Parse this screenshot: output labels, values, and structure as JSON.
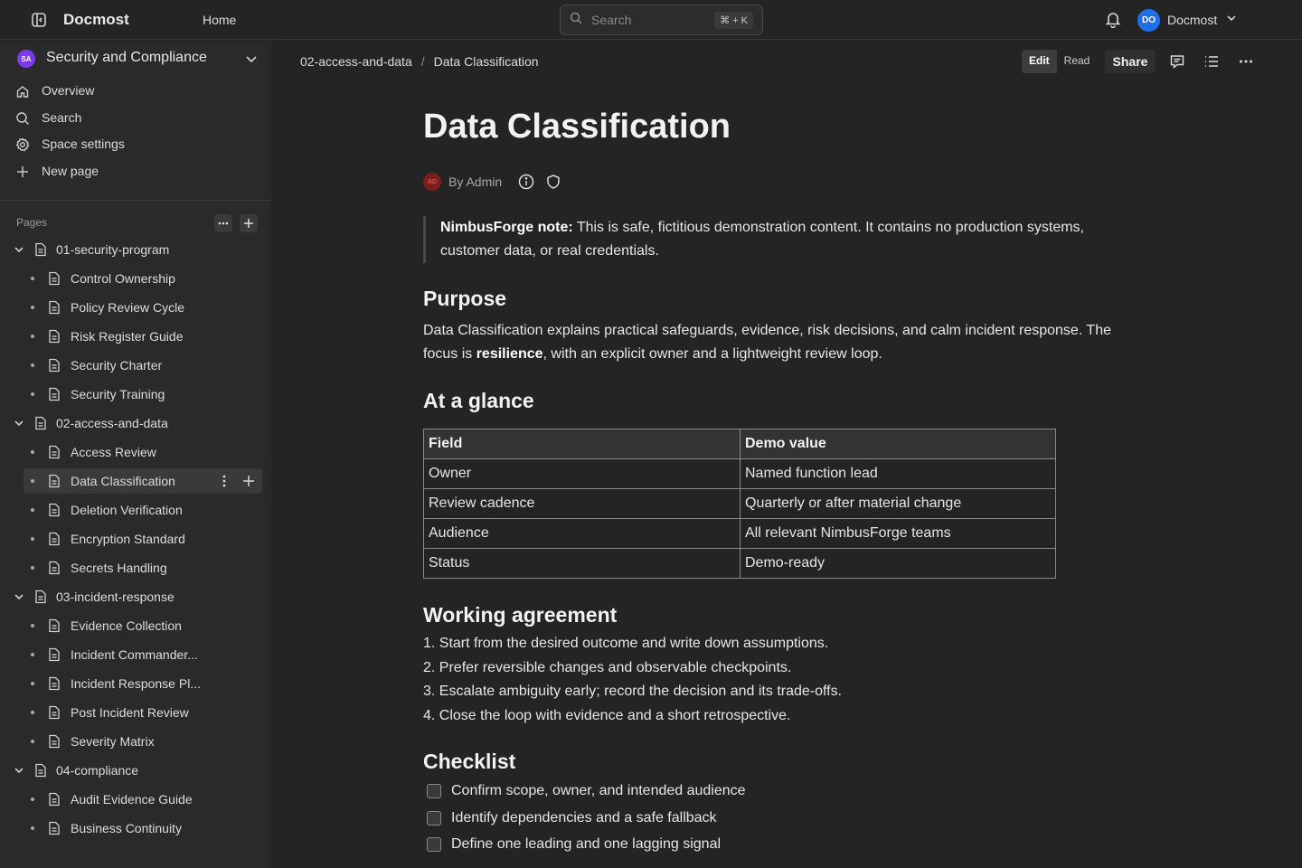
{
  "topbar": {
    "app_name": "Docmost",
    "home": "Home",
    "search_placeholder": "Search",
    "search_shortcut": "⌘ + K",
    "user_initials": "DO",
    "user_name": "Docmost"
  },
  "sidebar": {
    "space_initials": "SA",
    "space_name": "Security and Compliance",
    "nav": [
      {
        "label": "Overview",
        "icon": "home-icon"
      },
      {
        "label": "Search",
        "icon": "search-icon"
      },
      {
        "label": "Space settings",
        "icon": "gear-icon"
      },
      {
        "label": "New page",
        "icon": "plus-icon"
      }
    ],
    "pages_label": "Pages",
    "tree": [
      {
        "label": "01-security-program",
        "level": 0
      },
      {
        "label": "Control Ownership",
        "level": 1
      },
      {
        "label": "Policy Review Cycle",
        "level": 1
      },
      {
        "label": "Risk Register Guide",
        "level": 1
      },
      {
        "label": "Security Charter",
        "level": 1
      },
      {
        "label": "Security Training",
        "level": 1
      },
      {
        "label": "02-access-and-data",
        "level": 0
      },
      {
        "label": "Access Review",
        "level": 1
      },
      {
        "label": "Data Classification",
        "level": 1,
        "active": true
      },
      {
        "label": "Deletion Verification",
        "level": 1
      },
      {
        "label": "Encryption Standard",
        "level": 1
      },
      {
        "label": "Secrets Handling",
        "level": 1
      },
      {
        "label": "03-incident-response",
        "level": 0
      },
      {
        "label": "Evidence Collection",
        "level": 1
      },
      {
        "label": "Incident Commander...",
        "level": 1
      },
      {
        "label": "Incident Response Pl...",
        "level": 1
      },
      {
        "label": "Post Incident Review",
        "level": 1
      },
      {
        "label": "Severity Matrix",
        "level": 1
      },
      {
        "label": "04-compliance",
        "level": 0
      },
      {
        "label": "Audit Evidence Guide",
        "level": 1
      },
      {
        "label": "Business Continuity",
        "level": 1
      }
    ]
  },
  "header": {
    "breadcrumb": [
      "02-access-and-data",
      "Data Classification"
    ],
    "mode_edit": "Edit",
    "mode_read": "Read",
    "share": "Share"
  },
  "page": {
    "title": "Data Classification",
    "author_initials": "AD",
    "byline": "By Admin",
    "note_label": "NimbusForge note:",
    "note_text": " This is safe, fictitious demonstration content. It contains no production systems, customer data, or real credentials.",
    "purpose_heading": "Purpose",
    "purpose_pre": "Data Classification explains practical safeguards, evidence, risk decisions, and calm incident response. The focus is ",
    "purpose_bold": "resilience",
    "purpose_post": ", with an explicit owner and a lightweight review loop.",
    "glance_heading": "At a glance",
    "table_headers": [
      "Field",
      "Demo value"
    ],
    "table_rows": [
      [
        "Owner",
        "Named function lead"
      ],
      [
        "Review cadence",
        "Quarterly or after material change"
      ],
      [
        "Audience",
        "All relevant NimbusForge teams"
      ],
      [
        "Status",
        "Demo-ready"
      ]
    ],
    "agreement_heading": "Working agreement",
    "agreement_items": [
      "1. Start from the desired outcome and write down assumptions.",
      "2. Prefer reversible changes and observable checkpoints.",
      "3. Escalate ambiguity early; record the decision and its trade-offs.",
      "4. Close the loop with evidence and a short retrospective."
    ],
    "checklist_heading": "Checklist",
    "checklist_items": [
      "Confirm scope, owner, and intended audience",
      "Identify dependencies and a safe fallback",
      "Define one leading and one lagging signal"
    ]
  }
}
